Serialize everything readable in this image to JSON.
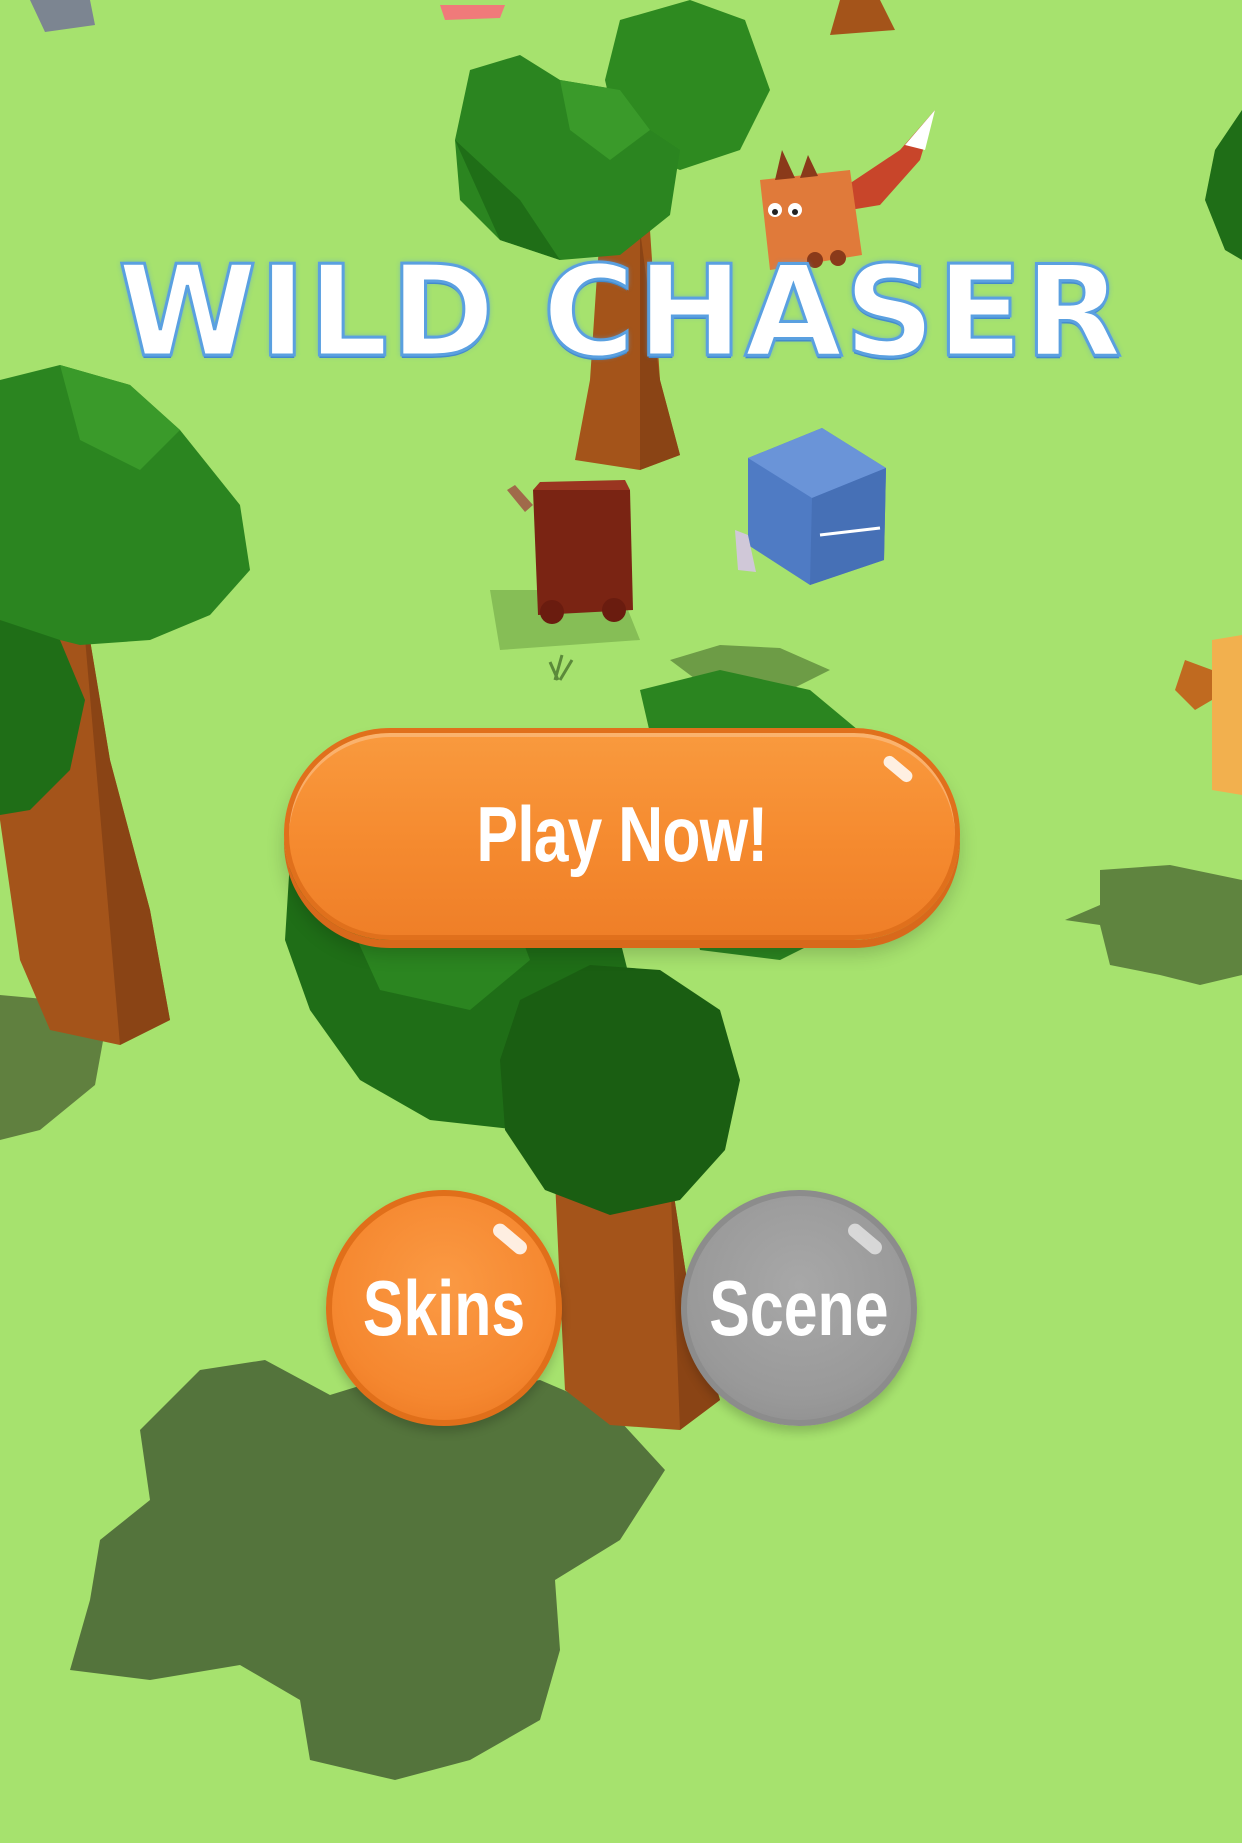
{
  "game": {
    "title": "WILD CHASER",
    "buttons": {
      "play": "Play Now!",
      "skins": "Skins",
      "scene": "Scene"
    }
  },
  "colors": {
    "grass": "#a6e26e",
    "shadow": "#54743c",
    "tree_dark": "#1f6e17",
    "tree_mid": "#2e8a20",
    "trunk": "#a4541a",
    "play_button": "#f58a2f",
    "skins_button": "#f5872f",
    "scene_button": "#999999",
    "title_outline": "#5aa0e0"
  }
}
